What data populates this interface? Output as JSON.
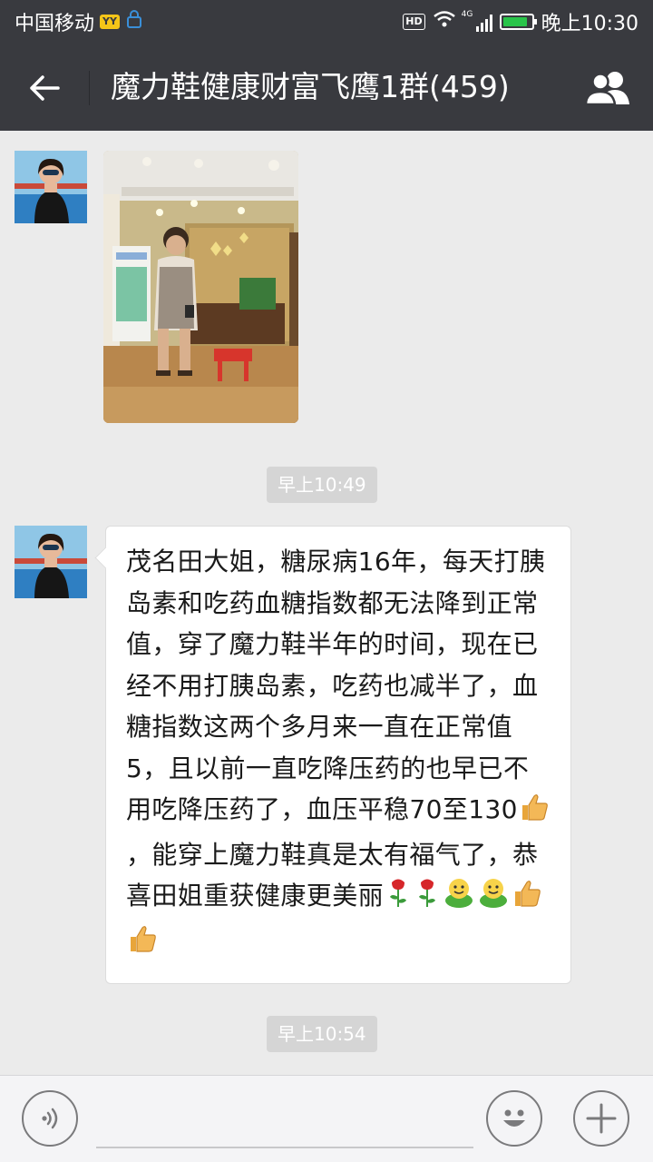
{
  "status_bar": {
    "carrier": "中国移动",
    "yy_badge": "YY",
    "hd_badge": "HD",
    "network": "4G",
    "battery_level": 0.9,
    "time": "晚上10:30"
  },
  "nav": {
    "title": "魔力鞋健康财富飞鹰1群(459)",
    "back_icon": "arrow-left-icon",
    "group_icon": "group-members-icon"
  },
  "messages": {
    "time_1": "早上10:49",
    "text_1": "茂名田大姐，糖尿病16年，每天打胰岛素和吃药血糖指数都无法降到正常值，穿了魔力鞋半年的时间，现在已经不用打胰岛素，吃药也减半了，血糖指数这两个多月来一直在正常值5，且以前一直吃降压药的也早已不用吃降压药了，血压平稳70至130",
    "text_2": "，能穿上魔力鞋真是太有福气了，恭喜田姐重获健康更美丽",
    "time_2": "早上10:54"
  },
  "input_bar": {
    "voice_icon": "voice-icon",
    "emoji_icon": "emoji-icon",
    "plus_icon": "plus-icon",
    "placeholder": ""
  },
  "colors": {
    "nav_bg": "#393a3f",
    "chat_bg": "#ebebeb",
    "time_label_bg": "#d5d5d5",
    "battery": "#29c44a"
  }
}
